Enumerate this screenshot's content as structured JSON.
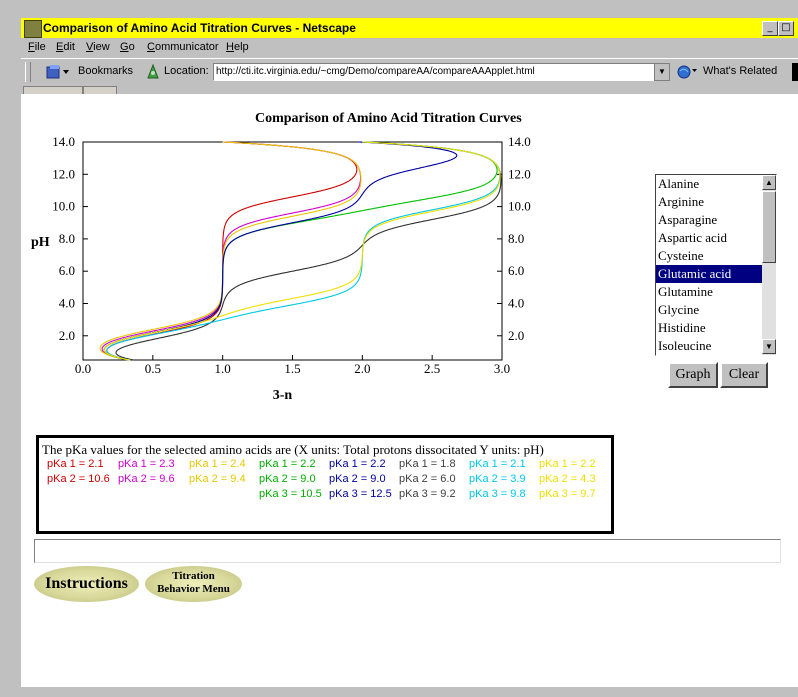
{
  "window": {
    "title": "Comparison of Amino Acid Titration Curves - Netscape",
    "controls": [
      "_",
      "□"
    ]
  },
  "menu": [
    "File",
    "Edit",
    "View",
    "Go",
    "Communicator",
    "Help"
  ],
  "locationbar": {
    "bookmarks_label": "Bookmarks",
    "location_label": "Location:",
    "url": "http://cti.itc.virginia.edu/~cmg/Demo/compareAA/compareAAApplet.html",
    "whats_related": "What's Related"
  },
  "chart_data": {
    "type": "line",
    "title": "Comparison of Amino Acid Titration Curves",
    "xlabel": "3-n",
    "ylabel": "pH",
    "xlim": [
      0,
      3
    ],
    "ylim": [
      0.5,
      14
    ],
    "x_ticks": [
      "0.0",
      "0.5",
      "1.0",
      "1.5",
      "2.0",
      "2.5",
      "3.0"
    ],
    "y_ticks": [
      "2.0",
      "4.0",
      "6.0",
      "8.0",
      "10.0",
      "12.0",
      "14.0"
    ],
    "series": [
      {
        "color": "#d00000",
        "pkas": [
          2.1,
          10.6
        ]
      },
      {
        "color": "#d000d0",
        "pkas": [
          2.3,
          9.6
        ]
      },
      {
        "color": "#e8c800",
        "pkas": [
          2.4,
          9.4
        ]
      },
      {
        "color": "#00c000",
        "pkas": [
          2.2,
          9.0,
          10.5
        ]
      },
      {
        "color": "#0000a0",
        "pkas": [
          2.2,
          9.0,
          12.5
        ]
      },
      {
        "color": "#303030",
        "pkas": [
          1.8,
          6.0,
          9.2
        ]
      },
      {
        "color": "#00c8e8",
        "pkas": [
          2.1,
          3.9,
          9.8
        ]
      },
      {
        "color": "#f0e000",
        "pkas": [
          2.2,
          4.3,
          9.7
        ]
      }
    ]
  },
  "list": {
    "options": [
      "Alanine",
      "Arginine",
      "Asparagine",
      "Aspartic acid",
      "Cysteine",
      "Glutamic acid",
      "Glutamine",
      "Glycine",
      "Histidine",
      "Isoleucine"
    ],
    "selected": "Glutamic acid"
  },
  "buttons": {
    "graph": "Graph",
    "clear": "Clear"
  },
  "pka_panel": {
    "heading": "The pKa values for the selected amino acids are (X units: Total protons dissocitated    Y units: pH)",
    "columns": [
      {
        "color": "#d00000",
        "rows": [
          "pKa 1 = 2.1",
          "pKa 2 = 10.6"
        ]
      },
      {
        "color": "#d000d0",
        "rows": [
          "pKa 1 = 2.3",
          "pKa 2 = 9.6"
        ]
      },
      {
        "color": "#e8c800",
        "rows": [
          "pKa 1 = 2.4",
          "pKa 2 = 9.4"
        ]
      },
      {
        "color": "#00b000",
        "rows": [
          "pKa 1 = 2.2",
          "pKa 2 = 9.0",
          "pKa 3 = 10.5"
        ]
      },
      {
        "color": "#0000a0",
        "rows": [
          "pKa 1 = 2.2",
          "pKa 2 = 9.0",
          "pKa 3 = 12.5"
        ]
      },
      {
        "color": "#404040",
        "rows": [
          "pKa 1 = 1.8",
          "pKa 2 = 6.0",
          "pKa 3 = 9.2"
        ]
      },
      {
        "color": "#00c8e8",
        "rows": [
          "pKa 1 = 2.1",
          "pKa 2 = 3.9",
          "pKa 3 = 9.8"
        ]
      },
      {
        "color": "#f0e000",
        "rows": [
          "pKa 1 = 2.2",
          "pKa 2 = 4.3",
          "pKa 3 = 9.7"
        ]
      }
    ]
  },
  "links": {
    "instructions": "Instructions",
    "titration_line1": "Titration",
    "titration_line2": "Behavior Menu"
  }
}
